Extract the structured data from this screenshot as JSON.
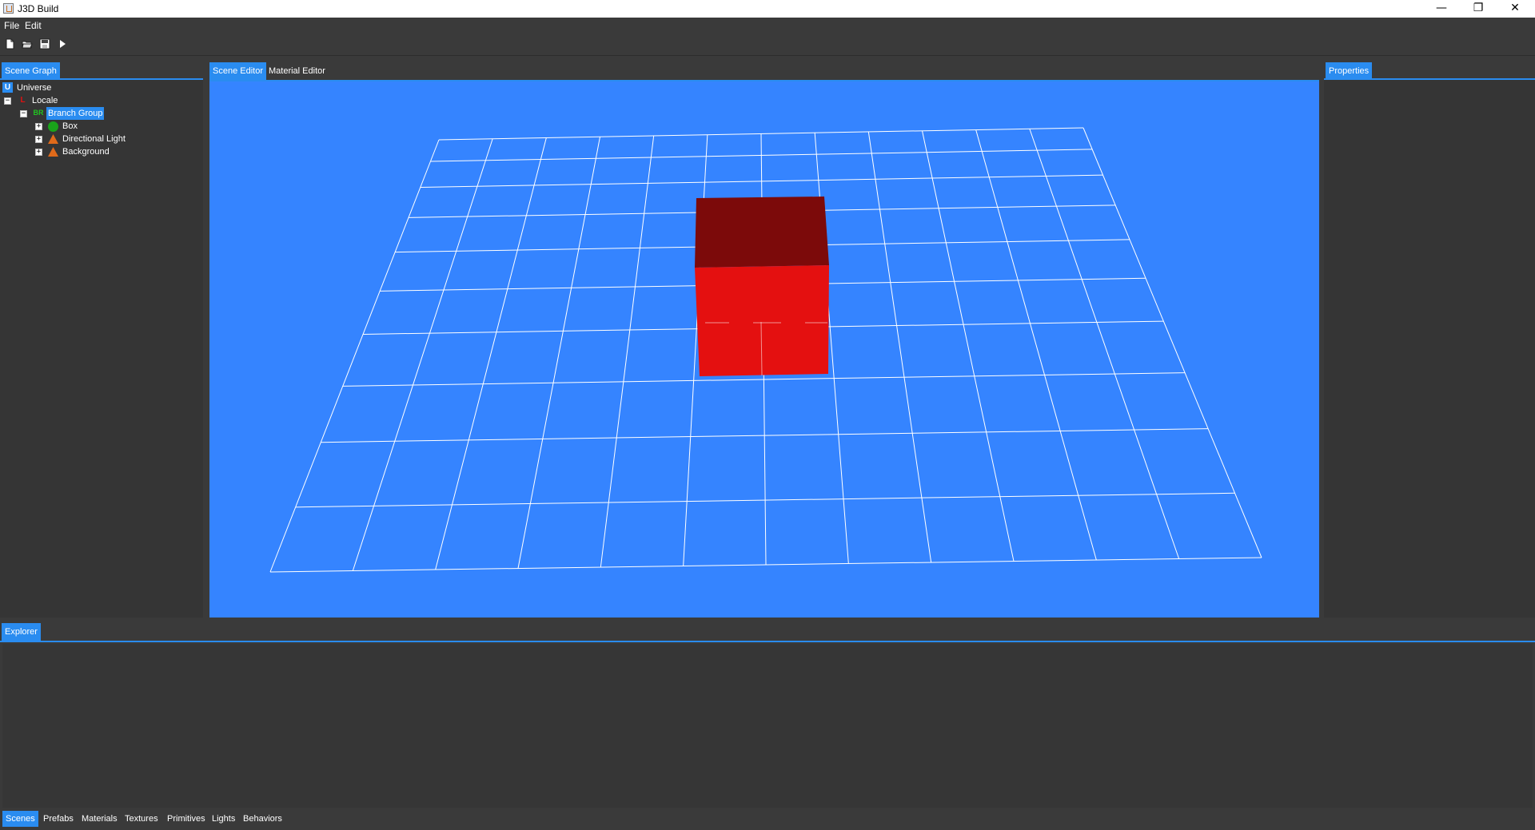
{
  "window": {
    "title": "J3D Build",
    "minimize": "—",
    "restore": "❐",
    "close": "✕"
  },
  "menu": {
    "items": [
      "File",
      "Edit"
    ]
  },
  "toolbar": {
    "icons": [
      "new-file-icon",
      "open-folder-icon",
      "save-icon",
      "play-icon"
    ]
  },
  "scene_graph": {
    "tab": "Scene Graph",
    "nodes": [
      {
        "badge": "U",
        "label": "Universe"
      },
      {
        "badge": "L",
        "label": "Locale"
      },
      {
        "badge": "BR",
        "label": "Branch Group"
      },
      {
        "label": "Box"
      },
      {
        "label": "Directional Light"
      },
      {
        "label": "Background"
      }
    ]
  },
  "editor": {
    "tabs": [
      "Scene Editor",
      "Material Editor"
    ],
    "active_tab": "Scene Editor"
  },
  "properties": {
    "tab": "Properties"
  },
  "explorer": {
    "tab": "Explorer"
  },
  "bottom_tabs": {
    "items": [
      "Scenes",
      "Prefabs",
      "Materials",
      "Textures",
      "Primitives",
      "Lights",
      "Behaviors"
    ],
    "active": "Scenes"
  },
  "colors": {
    "accent": "#2a8cf0",
    "viewport_bg": "#3584ff",
    "grid_line": "#ffffff",
    "cube_top": "#7c0a0a",
    "cube_front": "#e41010",
    "panel_bg": "#353535",
    "chrome_bg": "#3a3a3a"
  }
}
